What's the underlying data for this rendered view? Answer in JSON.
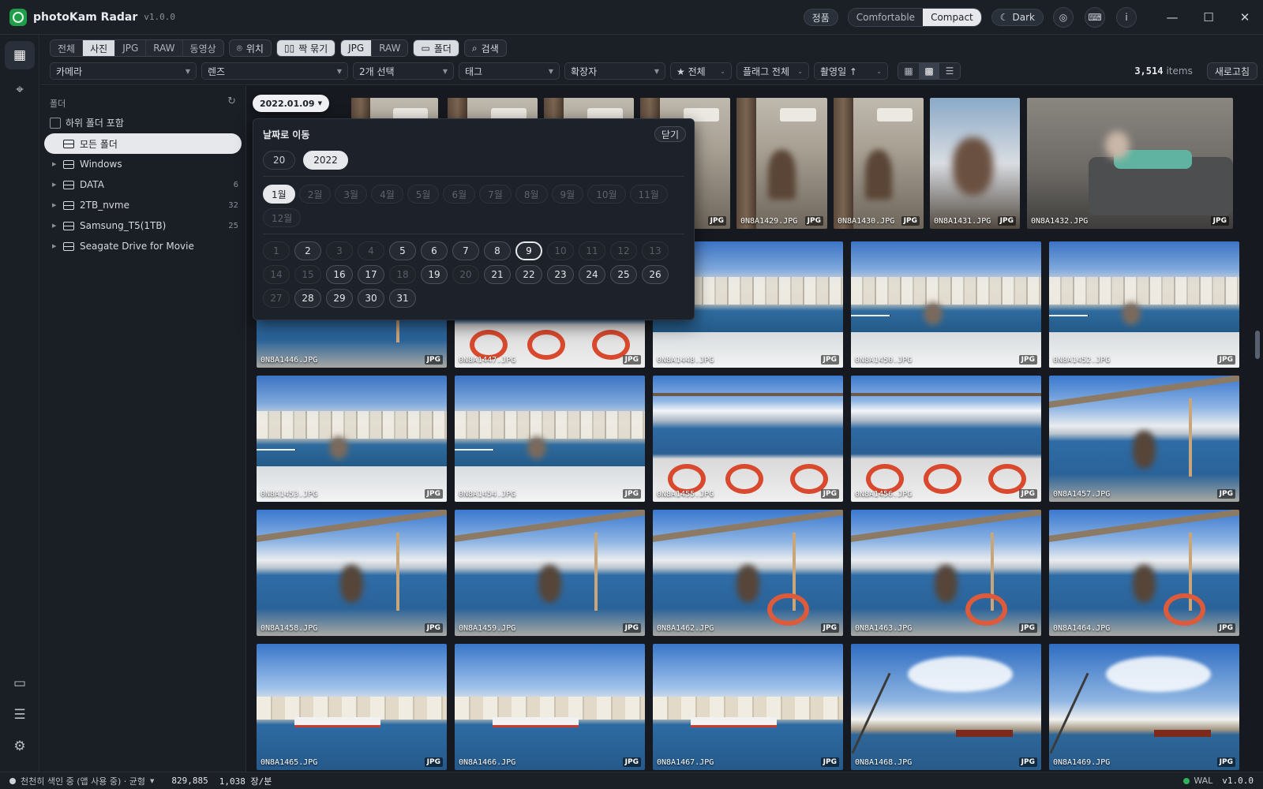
{
  "app": {
    "title": "photoKam Radar",
    "version": "v1.0.0"
  },
  "titlebar": {
    "license": "정품",
    "density": [
      "Comfortable",
      "Compact"
    ],
    "density_selected": "Compact",
    "theme": "Dark"
  },
  "toolbar": {
    "media_tabs": [
      "전체",
      "사진",
      "JPG",
      "RAW",
      "동영상"
    ],
    "media_selected": "사진",
    "location": "위치",
    "pair": "짝 묶기",
    "format_toggle": [
      "JPG",
      "RAW"
    ],
    "folder": "폴더",
    "search": "검색",
    "filters": {
      "camera": "카메라",
      "lens": "렌즈",
      "selected": "2개 선택",
      "tag": "태그",
      "extension": "확장자",
      "rating": "★ 전체",
      "flag": "플래그 전체",
      "sort": "촬영일 ↑"
    },
    "count": "3,514",
    "count_unit": "items",
    "refresh": "새로고침"
  },
  "folders": {
    "heading": "폴더",
    "include_sub": "하위 폴더 포함",
    "items": [
      {
        "label": "모든 폴더",
        "count": "",
        "selected": true
      },
      {
        "label": "Windows",
        "count": ""
      },
      {
        "label": "DATA",
        "count": "6"
      },
      {
        "label": "2TB_nvme",
        "count": "32"
      },
      {
        "label": "Samsung_T5(1TB)",
        "count": "25"
      },
      {
        "label": "Seagate Drive for Movie",
        "count": ""
      }
    ]
  },
  "date_chip": "2022.01.09",
  "jump": {
    "title": "날짜로 이동",
    "close": "닫기",
    "years": [
      "20",
      "2022"
    ],
    "year_selected": "2022",
    "months": [
      "1월",
      "2월",
      "3월",
      "4월",
      "5월",
      "6월",
      "7월",
      "8월",
      "9월",
      "10월",
      "11월",
      "12월"
    ],
    "month_selected": "1월",
    "days_with_photos": [
      2,
      5,
      6,
      7,
      8,
      9,
      16,
      17,
      19,
      21,
      22,
      23,
      24,
      25,
      26,
      28,
      29,
      30,
      31
    ],
    "day_selected": 9
  },
  "photos": {
    "row1": [
      {
        "name": "0N8A1429.JPG",
        "fmt": "JPG"
      },
      {
        "name": "0N8A1430.JPG",
        "fmt": "JPG"
      },
      {
        "name": "0N8A1431.JPG",
        "fmt": "JPG"
      },
      {
        "name": "0N8A1432.JPG",
        "fmt": "JPG"
      }
    ],
    "row2": [
      {
        "name": "0N8A1446.JPG",
        "fmt": "JPG"
      },
      {
        "name": "0N8A1447.JPG",
        "fmt": "JPG"
      },
      {
        "name": "0N8A1448.JPG",
        "fmt": "JPG"
      },
      {
        "name": "0N8A1450.JPG",
        "fmt": "JPG"
      },
      {
        "name": "0N8A1452.JPG",
        "fmt": "JPG"
      }
    ],
    "row3": [
      {
        "name": "0N8A1453.JPG",
        "fmt": "JPG"
      },
      {
        "name": "0N8A1454.JPG",
        "fmt": "JPG"
      },
      {
        "name": "0N8A1455.JPG",
        "fmt": "JPG"
      },
      {
        "name": "0N8A1456.JPG",
        "fmt": "JPG"
      },
      {
        "name": "0N8A1457.JPG",
        "fmt": "JPG"
      }
    ],
    "row4": [
      {
        "name": "0N8A1458.JPG",
        "fmt": "JPG"
      },
      {
        "name": "0N8A1459.JPG",
        "fmt": "JPG"
      },
      {
        "name": "0N8A1462.JPG",
        "fmt": "JPG"
      },
      {
        "name": "0N8A1463.JPG",
        "fmt": "JPG"
      },
      {
        "name": "0N8A1464.JPG",
        "fmt": "JPG"
      }
    ],
    "row5": [
      {
        "name": "0N8A1465.JPG",
        "fmt": "JPG"
      },
      {
        "name": "0N8A1466.JPG",
        "fmt": "JPG"
      },
      {
        "name": "0N8A1467.JPG",
        "fmt": "JPG"
      },
      {
        "name": "0N8A1468.JPG",
        "fmt": "JPG"
      },
      {
        "name": "0N8A1469.JPG",
        "fmt": "JPG"
      }
    ],
    "row1_hidden_fmt": "JPG"
  },
  "status": {
    "indexing": "천천히 색인 중 (앱 사용 중) · 균형",
    "indexed": "829,885",
    "rate": "1,038 장/분",
    "wal": "WAL",
    "version": "v1.0.0"
  },
  "colors": {
    "accent_green": "#1f9d4a",
    "selected_fill": "#e6e8ec",
    "wal_dot": "#2fb35a"
  }
}
